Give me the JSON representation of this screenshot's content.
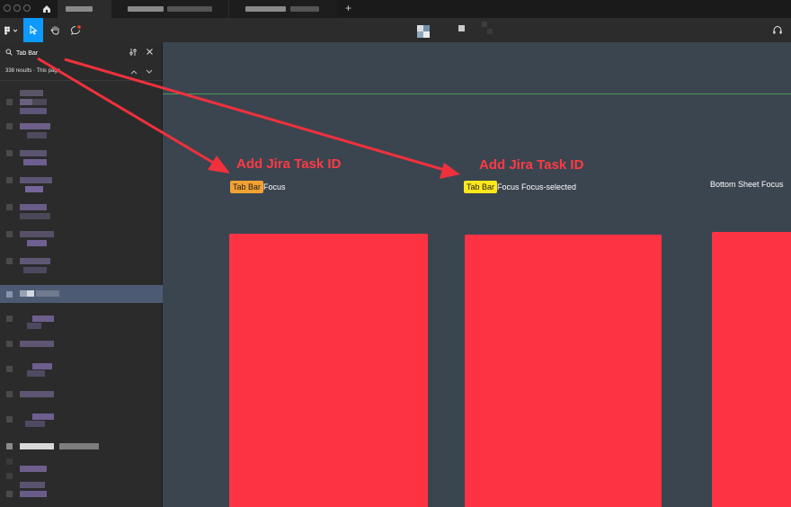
{
  "tabs": {
    "home_icon": "home-icon",
    "new_tab_label": "+"
  },
  "toolbar": {
    "main_menu_icon": "figma-menu-icon",
    "move_tool_icon": "cursor-icon",
    "hand_tool_icon": "hand-icon",
    "comment_tool_icon": "comment-icon",
    "audio_icon": "headphones-icon"
  },
  "search": {
    "value": "Tab Bar",
    "results_text": "338 results · This page"
  },
  "canvas": {
    "annotations": [
      "Add Jira Task ID",
      "Add Jira Task ID"
    ],
    "frames": [
      {
        "highlight": "Tab Bar",
        "suffix": "Focus"
      },
      {
        "highlight": "Tab Bar",
        "suffix": "Focus Focus-selected"
      },
      {
        "label": "Bottom Sheet Focus"
      }
    ]
  },
  "colors": {
    "accent": "#0d99ff",
    "frame_fill": "#fd3344",
    "annotation": "#ff3a44",
    "highlight_primary": "#f2a233",
    "highlight_secondary": "#ffe81a",
    "canvas_bg": "#3b4550",
    "selected_row": "#4d5a73"
  }
}
